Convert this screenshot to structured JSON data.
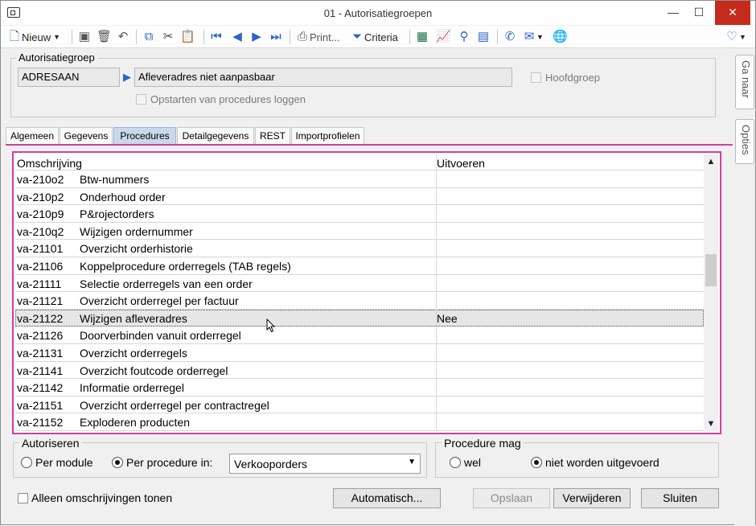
{
  "window": {
    "title": "01 - Autorisatiegroepen"
  },
  "toolbar": {
    "new_label": "Nieuw",
    "print_label": "Print...",
    "criteria_label": "Criteria"
  },
  "side_tabs": [
    "Ga naar",
    "Opties"
  ],
  "header": {
    "group_legend": "Autorisatiegroep",
    "code": "ADRESAAN",
    "description": "Afleveradres niet aanpasbaar",
    "hoofdgroep_label": "Hoofdgroep",
    "log_label": "Opstarten van procedures loggen"
  },
  "tabs": [
    "Algemeen",
    "Gegevens",
    "Procedures",
    "Detailgegevens",
    "REST",
    "Importprofielen"
  ],
  "active_tab": "Procedures",
  "grid": {
    "col_omschrijving": "Omschrijving",
    "col_uitvoeren": "Uitvoeren",
    "rows": [
      {
        "code": "va-210o2",
        "desc": "Btw-nummers",
        "value": ""
      },
      {
        "code": "va-210p2",
        "desc": "Onderhoud order",
        "value": ""
      },
      {
        "code": "va-210p9",
        "desc": "P&rojectorders",
        "value": ""
      },
      {
        "code": "va-210q2",
        "desc": "Wijzigen ordernummer",
        "value": ""
      },
      {
        "code": "va-21101",
        "desc": "Overzicht orderhistorie",
        "value": ""
      },
      {
        "code": "va-21106",
        "desc": "Koppelprocedure orderregels (TAB regels)",
        "value": ""
      },
      {
        "code": "va-21111",
        "desc": "Selectie orderregels van een order",
        "value": ""
      },
      {
        "code": "va-21121",
        "desc": "Overzicht orderregel per factuur",
        "value": ""
      },
      {
        "code": "va-21122",
        "desc": "Wijzigen afleveradres",
        "value": "Nee"
      },
      {
        "code": "va-21126",
        "desc": "Doorverbinden vanuit orderregel",
        "value": ""
      },
      {
        "code": "va-21131",
        "desc": "Overzicht orderregels",
        "value": ""
      },
      {
        "code": "va-21141",
        "desc": "Overzicht foutcode orderregel",
        "value": ""
      },
      {
        "code": "va-21142",
        "desc": "Informatie orderregel",
        "value": ""
      },
      {
        "code": "va-21151",
        "desc": "Overzicht orderregel per contractregel",
        "value": ""
      },
      {
        "code": "va-21152",
        "desc": "Exploderen producten",
        "value": ""
      }
    ],
    "selected_index": 8
  },
  "autoriseren": {
    "legend": "Autoriseren",
    "per_module": "Per module",
    "per_procedure": "Per procedure in:",
    "combo_value": "Verkooporders"
  },
  "procedure_mag": {
    "legend": "Procedure mag",
    "wel": "wel",
    "niet": "niet worden uitgevoerd"
  },
  "footer": {
    "alleen_label": "Alleen omschrijvingen tonen",
    "automatisch": "Automatisch...",
    "opslaan": "Opslaan",
    "verwijderen": "Verwijderen",
    "sluiten": "Sluiten"
  }
}
